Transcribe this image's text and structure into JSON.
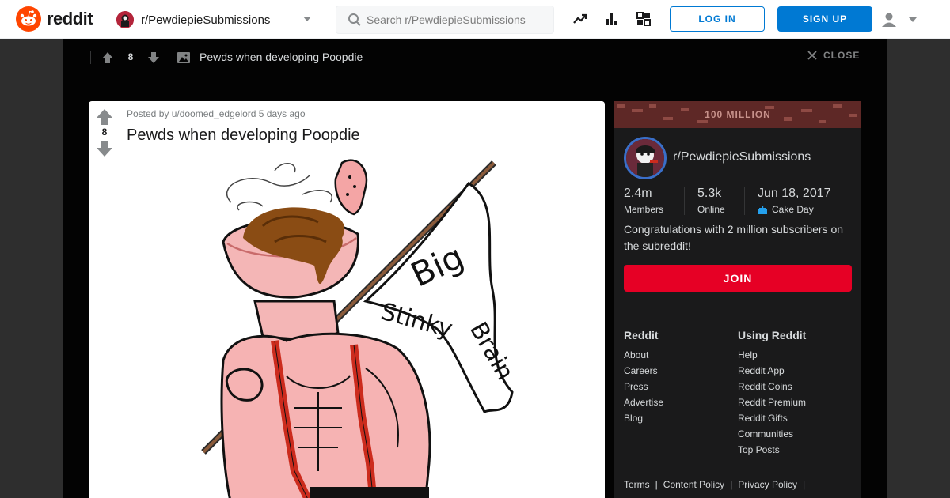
{
  "header": {
    "brand": "reddit",
    "subreddit": "r/PewdiepieSubmissions",
    "search_placeholder": "Search r/PewdiepieSubmissions",
    "login_label": "LOG IN",
    "signup_label": "SIGN UP",
    "icons": [
      "trending-icon",
      "stats-icon",
      "coins-icon",
      "user-icon",
      "chevron-down-icon"
    ]
  },
  "post_bar": {
    "score": "8",
    "title": "Pewds when developing Poopdie",
    "close_label": "CLOSE"
  },
  "post": {
    "score": "8",
    "meta": "Posted by u/doomed_edgelord 5 days ago",
    "title": "Pewds when developing Poopdie",
    "image_flag_text": [
      "Big",
      "Stinky",
      "Brain"
    ]
  },
  "sidebar": {
    "banner_text": "100 MILLION",
    "community_name": "r/PewdiepieSubmissions",
    "stats": [
      {
        "value": "2.4m",
        "label": "Members"
      },
      {
        "value": "5.3k",
        "label": "Online"
      },
      {
        "value": "Jun 18, 2017",
        "label": "Cake Day"
      }
    ],
    "description": "Congratulations with 2 million subscribers on the subreddit!",
    "join_label": "JOIN",
    "link_columns": [
      {
        "heading": "Reddit",
        "links": [
          "About",
          "Careers",
          "Press",
          "Advertise",
          "Blog"
        ]
      },
      {
        "heading": "Using Reddit",
        "links": [
          "Help",
          "Reddit App",
          "Reddit Coins",
          "Reddit Premium",
          "Reddit Gifts",
          "Communities",
          "Top Posts"
        ]
      }
    ],
    "footer_links": [
      "Terms",
      "Content Policy",
      "Privacy Policy"
    ],
    "footer_separator": "|"
  },
  "colors": {
    "brand_orange": "#ff4500",
    "primary_blue": "#0079d3",
    "join_red": "#e60025",
    "overlay_black": "#030303",
    "card_dark": "#1a1a1b"
  }
}
